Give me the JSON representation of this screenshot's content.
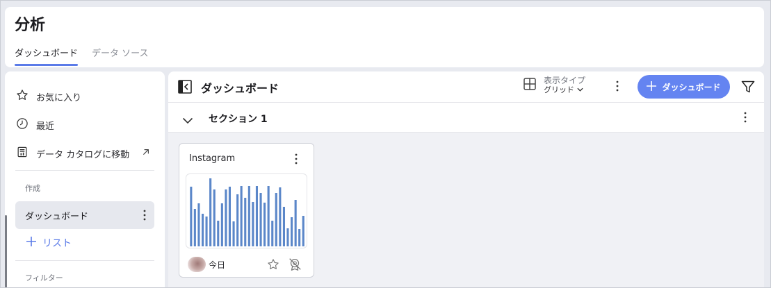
{
  "header": {
    "title": "分析",
    "tabs": [
      {
        "label": "ダッシュボード",
        "active": true
      },
      {
        "label": "データ ソース",
        "active": false
      }
    ]
  },
  "sidebar": {
    "items": [
      {
        "label": "お気に入り",
        "icon": "star-icon"
      },
      {
        "label": "最近",
        "icon": "clock-icon"
      },
      {
        "label": "データ カタログに移動",
        "icon": "catalog-icon",
        "trailing_icon": "external-arrow-icon"
      }
    ],
    "create_heading": "作成",
    "dashboard_item": "ダッシュボード",
    "list_label": "リスト",
    "filter_heading": "フィルター"
  },
  "toolbar": {
    "title": "ダッシュボード",
    "view_type_label": "表示タイプ",
    "view_type_value": "グリッド",
    "add_button": "ダッシュボード"
  },
  "section": {
    "title": "セクション 1"
  },
  "card": {
    "title": "Instagram",
    "date": "今日"
  },
  "chart_data": {
    "type": "bar",
    "values": [
      86,
      54,
      62,
      47,
      43,
      98,
      82,
      37,
      62,
      82,
      86,
      36,
      75,
      87,
      70,
      87,
      64,
      87,
      77,
      63,
      87,
      37,
      77,
      85,
      57,
      26,
      42,
      67,
      25,
      44
    ],
    "ylim": [
      0,
      100
    ],
    "color": "#5b87c9"
  },
  "colors": {
    "accent": "#6484f1",
    "tab_underline": "#5b7be8"
  }
}
